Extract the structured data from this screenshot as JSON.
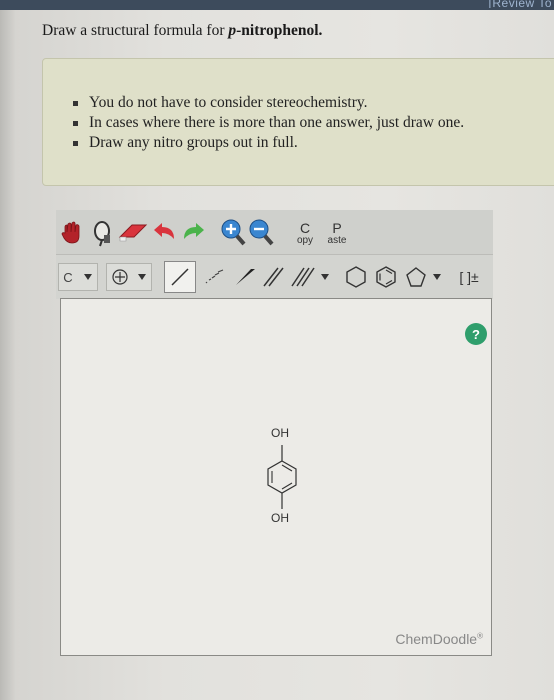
{
  "header": {
    "review_link": "[Review To"
  },
  "question": {
    "prefix": "Draw a structural formula for ",
    "p": "p",
    "compound": "-nitrophenol."
  },
  "hints": [
    "You do not have to consider stereochemistry.",
    "In cases where there is more than one answer, just draw one.",
    "Draw any nitro groups out in full."
  ],
  "toolbar": {
    "copy_big": "C",
    "copy_small": "opy",
    "paste_big": "P",
    "paste_small": "aste",
    "element": "C",
    "charge": "[ ]±"
  },
  "canvas": {
    "help": "?",
    "top_label": "OH",
    "bottom_label": "OH",
    "brand": "ChemDoodle"
  },
  "colors": {
    "topbar": "#3d4b5c",
    "hint_box": "#dfe0c9",
    "help_green": "#2f9e6c",
    "canvas_bg": "#ecebe7"
  }
}
